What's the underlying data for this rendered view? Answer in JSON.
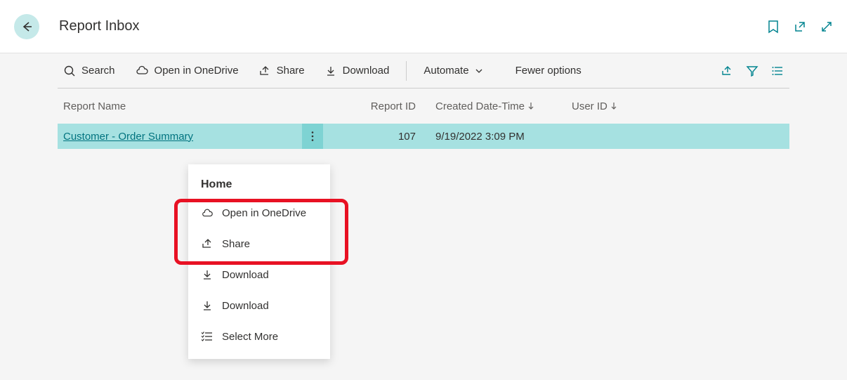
{
  "header": {
    "title": "Report Inbox"
  },
  "toolbar": {
    "search_label": "Search",
    "onedrive_label": "Open in OneDrive",
    "share_label": "Share",
    "download_label": "Download",
    "automate_label": "Automate",
    "fewer_options_label": "Fewer options"
  },
  "table": {
    "columns": {
      "name": "Report Name",
      "id": "Report ID",
      "date": "Created Date-Time",
      "user": "User ID"
    },
    "rows": [
      {
        "name": "Customer - Order Summary",
        "id": "107",
        "date": "9/19/2022 3:09 PM",
        "user": ""
      }
    ]
  },
  "context_menu": {
    "header": "Home",
    "items": [
      {
        "label": "Open in OneDrive",
        "icon": "cloud"
      },
      {
        "label": "Share",
        "icon": "share"
      },
      {
        "label": "Download",
        "icon": "download"
      },
      {
        "label": "Download",
        "icon": "download"
      },
      {
        "label": "Select More",
        "icon": "list"
      }
    ]
  }
}
